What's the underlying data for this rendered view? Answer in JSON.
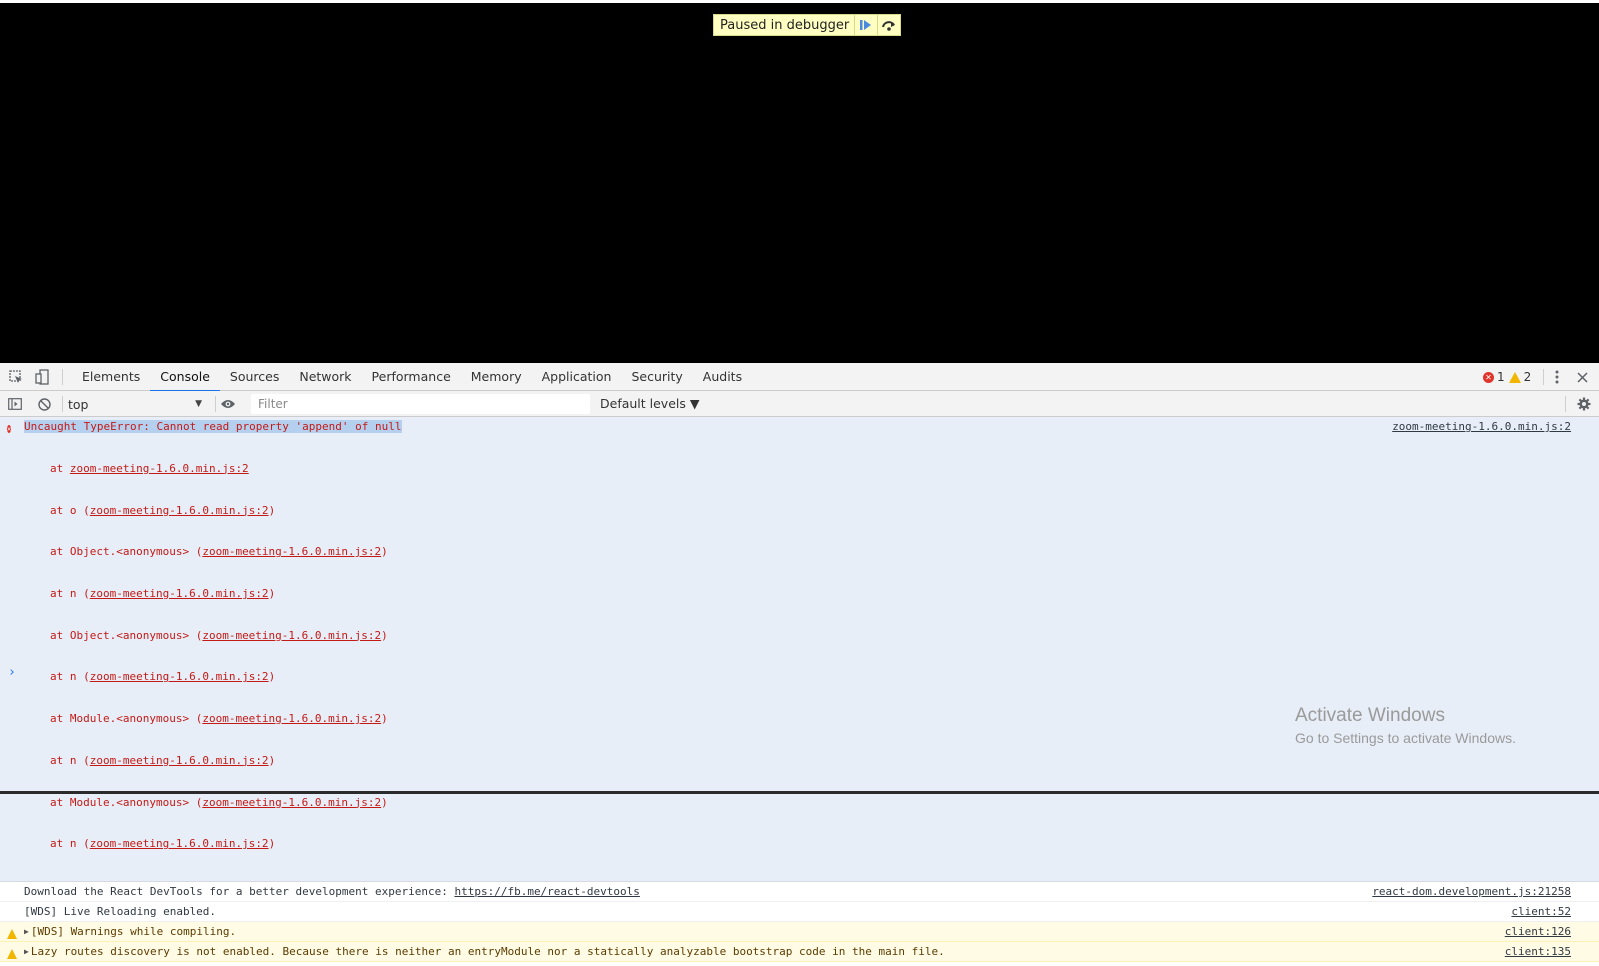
{
  "viewport": {
    "paused_label": "Paused in debugger",
    "resume_icon": "resume-icon",
    "step_over_icon": "step-over-icon"
  },
  "tabbar": {
    "inspect_icon": "inspect-element-icon",
    "device_icon": "device-toolbar-icon",
    "tabs": [
      {
        "label": "Elements"
      },
      {
        "label": "Console",
        "active": true
      },
      {
        "label": "Sources"
      },
      {
        "label": "Network"
      },
      {
        "label": "Performance"
      },
      {
        "label": "Memory"
      },
      {
        "label": "Application"
      },
      {
        "label": "Security"
      },
      {
        "label": "Audits"
      }
    ],
    "error_count": "1",
    "warning_count": "2",
    "menu_icon": "more-vertical-icon",
    "close_icon": "close-icon"
  },
  "toolbar": {
    "sidebar_icon": "sidebar-toggle-icon",
    "clear_icon": "clear-console-icon",
    "context": "top",
    "eye_icon": "eye-icon",
    "filter_placeholder": "Filter",
    "filter_value": "",
    "levels": "Default levels ▼",
    "settings_icon": "gear-icon"
  },
  "console": {
    "error": {
      "message": "Uncaught TypeError: Cannot read property 'append' of null",
      "source": "zoom-meeting-1.6.0.min.js:2",
      "stack": [
        {
          "prefix": "at ",
          "link": "zoom-meeting-1.6.0.min.js:2",
          "suffix": ""
        },
        {
          "prefix": "at o (",
          "link": "zoom-meeting-1.6.0.min.js:2",
          "suffix": ")"
        },
        {
          "prefix": "at Object.<anonymous> (",
          "link": "zoom-meeting-1.6.0.min.js:2",
          "suffix": ")"
        },
        {
          "prefix": "at n (",
          "link": "zoom-meeting-1.6.0.min.js:2",
          "suffix": ")"
        },
        {
          "prefix": "at Object.<anonymous> (",
          "link": "zoom-meeting-1.6.0.min.js:2",
          "suffix": ")"
        },
        {
          "prefix": "at n (",
          "link": "zoom-meeting-1.6.0.min.js:2",
          "suffix": ")"
        },
        {
          "prefix": "at Module.<anonymous> (",
          "link": "zoom-meeting-1.6.0.min.js:2",
          "suffix": ")"
        },
        {
          "prefix": "at n (",
          "link": "zoom-meeting-1.6.0.min.js:2",
          "suffix": ")"
        },
        {
          "prefix": "at Module.<anonymous> (",
          "link": "zoom-meeting-1.6.0.min.js:2",
          "suffix": ")"
        },
        {
          "prefix": "at n (",
          "link": "zoom-meeting-1.6.0.min.js:2",
          "suffix": ")"
        }
      ]
    },
    "messages": [
      {
        "type": "info",
        "text": "Download the React DevTools for a better development experience: ",
        "link": "https://fb.me/react-devtools",
        "source": "react-dom.development.js:21258"
      },
      {
        "type": "info",
        "text": "[WDS] Live Reloading enabled.",
        "source": "client:52"
      },
      {
        "type": "warn",
        "text": "[WDS] Warnings while compiling.",
        "source": "client:126",
        "expandable": true
      },
      {
        "type": "warn",
        "text": "Lazy routes discovery is not enabled. Because there is neither an entryModule nor a statically analyzable bootstrap code in the main file.",
        "source": "client:135",
        "expandable": true
      }
    ],
    "prompt": "›"
  },
  "watermark": {
    "line1": "Activate Windows",
    "line2": "Go to Settings to activate Windows."
  },
  "colors": {
    "accent": "#1a73e8",
    "error_text": "#c41a16",
    "warning_bg": "#fffbe5",
    "error_bg": "#e8eef7"
  }
}
